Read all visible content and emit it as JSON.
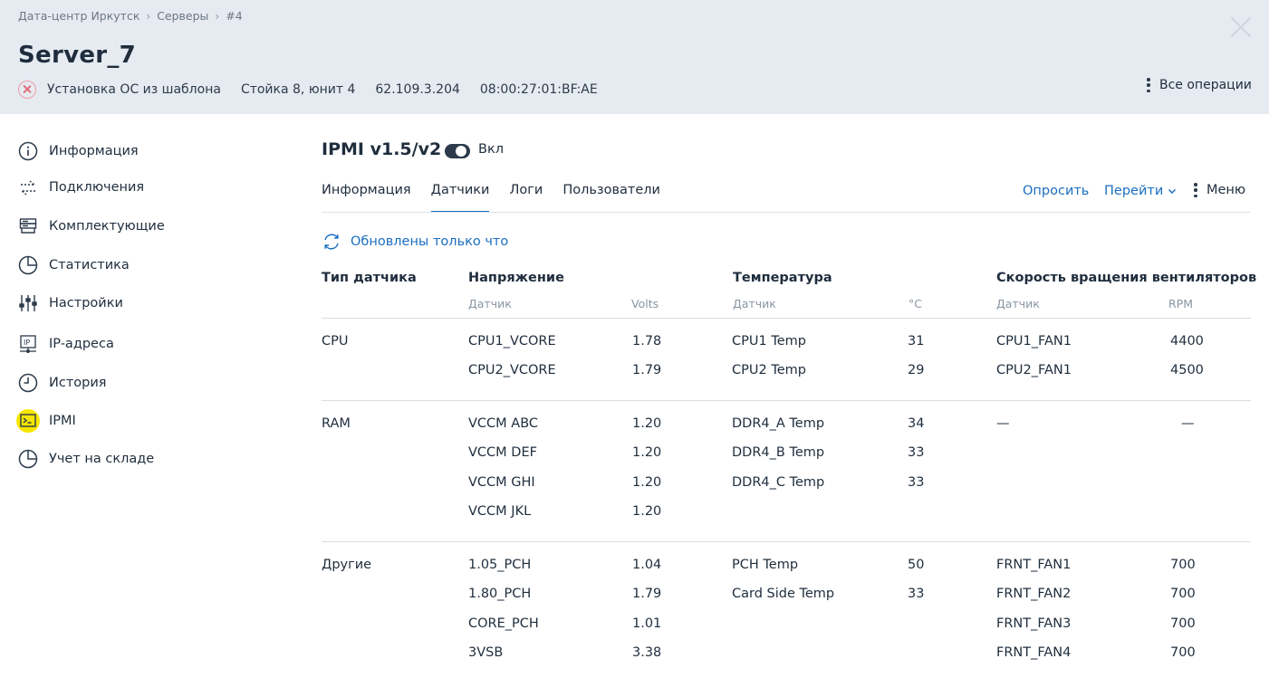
{
  "header": {
    "breadcrumb": [
      "Дата-центр Иркутск",
      "Серверы",
      "#4"
    ],
    "title": "Server_7",
    "status_text": "Установка ОС из шаблона",
    "rack": "Стойка 8, юнит 4",
    "ip": "62.109.3.204",
    "mac": "08:00:27:01:BF:AE",
    "all_operations": "Все операции"
  },
  "sidebar": {
    "items": [
      {
        "label": "Информация",
        "icon": "info-icon"
      },
      {
        "label": "Подключения",
        "icon": "connections-icon"
      },
      {
        "label": "Комплектующие",
        "icon": "components-icon"
      },
      {
        "label": "Статистика",
        "icon": "pie-chart-icon"
      },
      {
        "label": "Настройки",
        "icon": "sliders-icon"
      },
      {
        "label": "IP-адреса",
        "icon": "ip-icon"
      },
      {
        "label": "История",
        "icon": "clock-icon"
      },
      {
        "label": "IPMI",
        "icon": "terminal-icon",
        "active": true
      },
      {
        "label": "Учет на складе",
        "icon": "pie-chart-icon"
      }
    ]
  },
  "ipmi": {
    "title": "IPMI v1.5/v2",
    "toggle_label": "Вкл",
    "tabs": [
      "Информация",
      "Датчики",
      "Логи",
      "Пользователи"
    ],
    "active_tab": "Датчики",
    "actions": {
      "poll": "Опросить",
      "goto": "Перейти",
      "menu": "Меню"
    },
    "refresh_status": "Обновлены только что"
  },
  "table": {
    "headers": {
      "sensor_type": "Тип датчика",
      "voltage": "Напряжение",
      "temperature": "Температура",
      "fan": "Скорость вращения вентиляторов"
    },
    "subheaders": {
      "voltage_sensor": "Датчик",
      "voltage_unit": "Volts",
      "temp_sensor": "Датчик",
      "temp_unit": "°C",
      "fan_sensor": "Датчик",
      "fan_unit": "RPM"
    },
    "groups": [
      {
        "type": "CPU",
        "voltage": [
          [
            "CPU1_VCORE",
            "1.78"
          ],
          [
            "CPU2_VCORE",
            "1.79"
          ]
        ],
        "temperature": [
          [
            "CPU1 Temp",
            "31"
          ],
          [
            "CPU2 Temp",
            "29"
          ]
        ],
        "fan": [
          [
            "CPU1_FAN1",
            "4400"
          ],
          [
            "CPU2_FAN1",
            "4500"
          ]
        ]
      },
      {
        "type": "RAM",
        "voltage": [
          [
            "VCCM ABC",
            "1.20"
          ],
          [
            "VCCM DEF",
            "1.20"
          ],
          [
            "VCCM GHI",
            "1.20"
          ],
          [
            "VCCM JKL",
            "1.20"
          ]
        ],
        "temperature": [
          [
            "DDR4_A Temp",
            "34"
          ],
          [
            "DDR4_B Temp",
            "33"
          ],
          [
            "DDR4_C Temp",
            "33"
          ]
        ],
        "fan": [
          [
            "—",
            "—"
          ]
        ]
      },
      {
        "type": "Другие",
        "voltage": [
          [
            "1.05_PCH",
            "1.04"
          ],
          [
            "1.80_PCH",
            "1.79"
          ],
          [
            "CORE_PCH",
            "1.01"
          ],
          [
            "3VSB",
            "3.38"
          ]
        ],
        "temperature": [
          [
            "PCH Temp",
            "50"
          ],
          [
            "Card Side Temp",
            "33"
          ]
        ],
        "fan": [
          [
            "FRNT_FAN1",
            "700"
          ],
          [
            "FRNT_FAN2",
            "700"
          ],
          [
            "FRNT_FAN3",
            "700"
          ],
          [
            "FRNT_FAN4",
            "700"
          ]
        ]
      }
    ]
  }
}
